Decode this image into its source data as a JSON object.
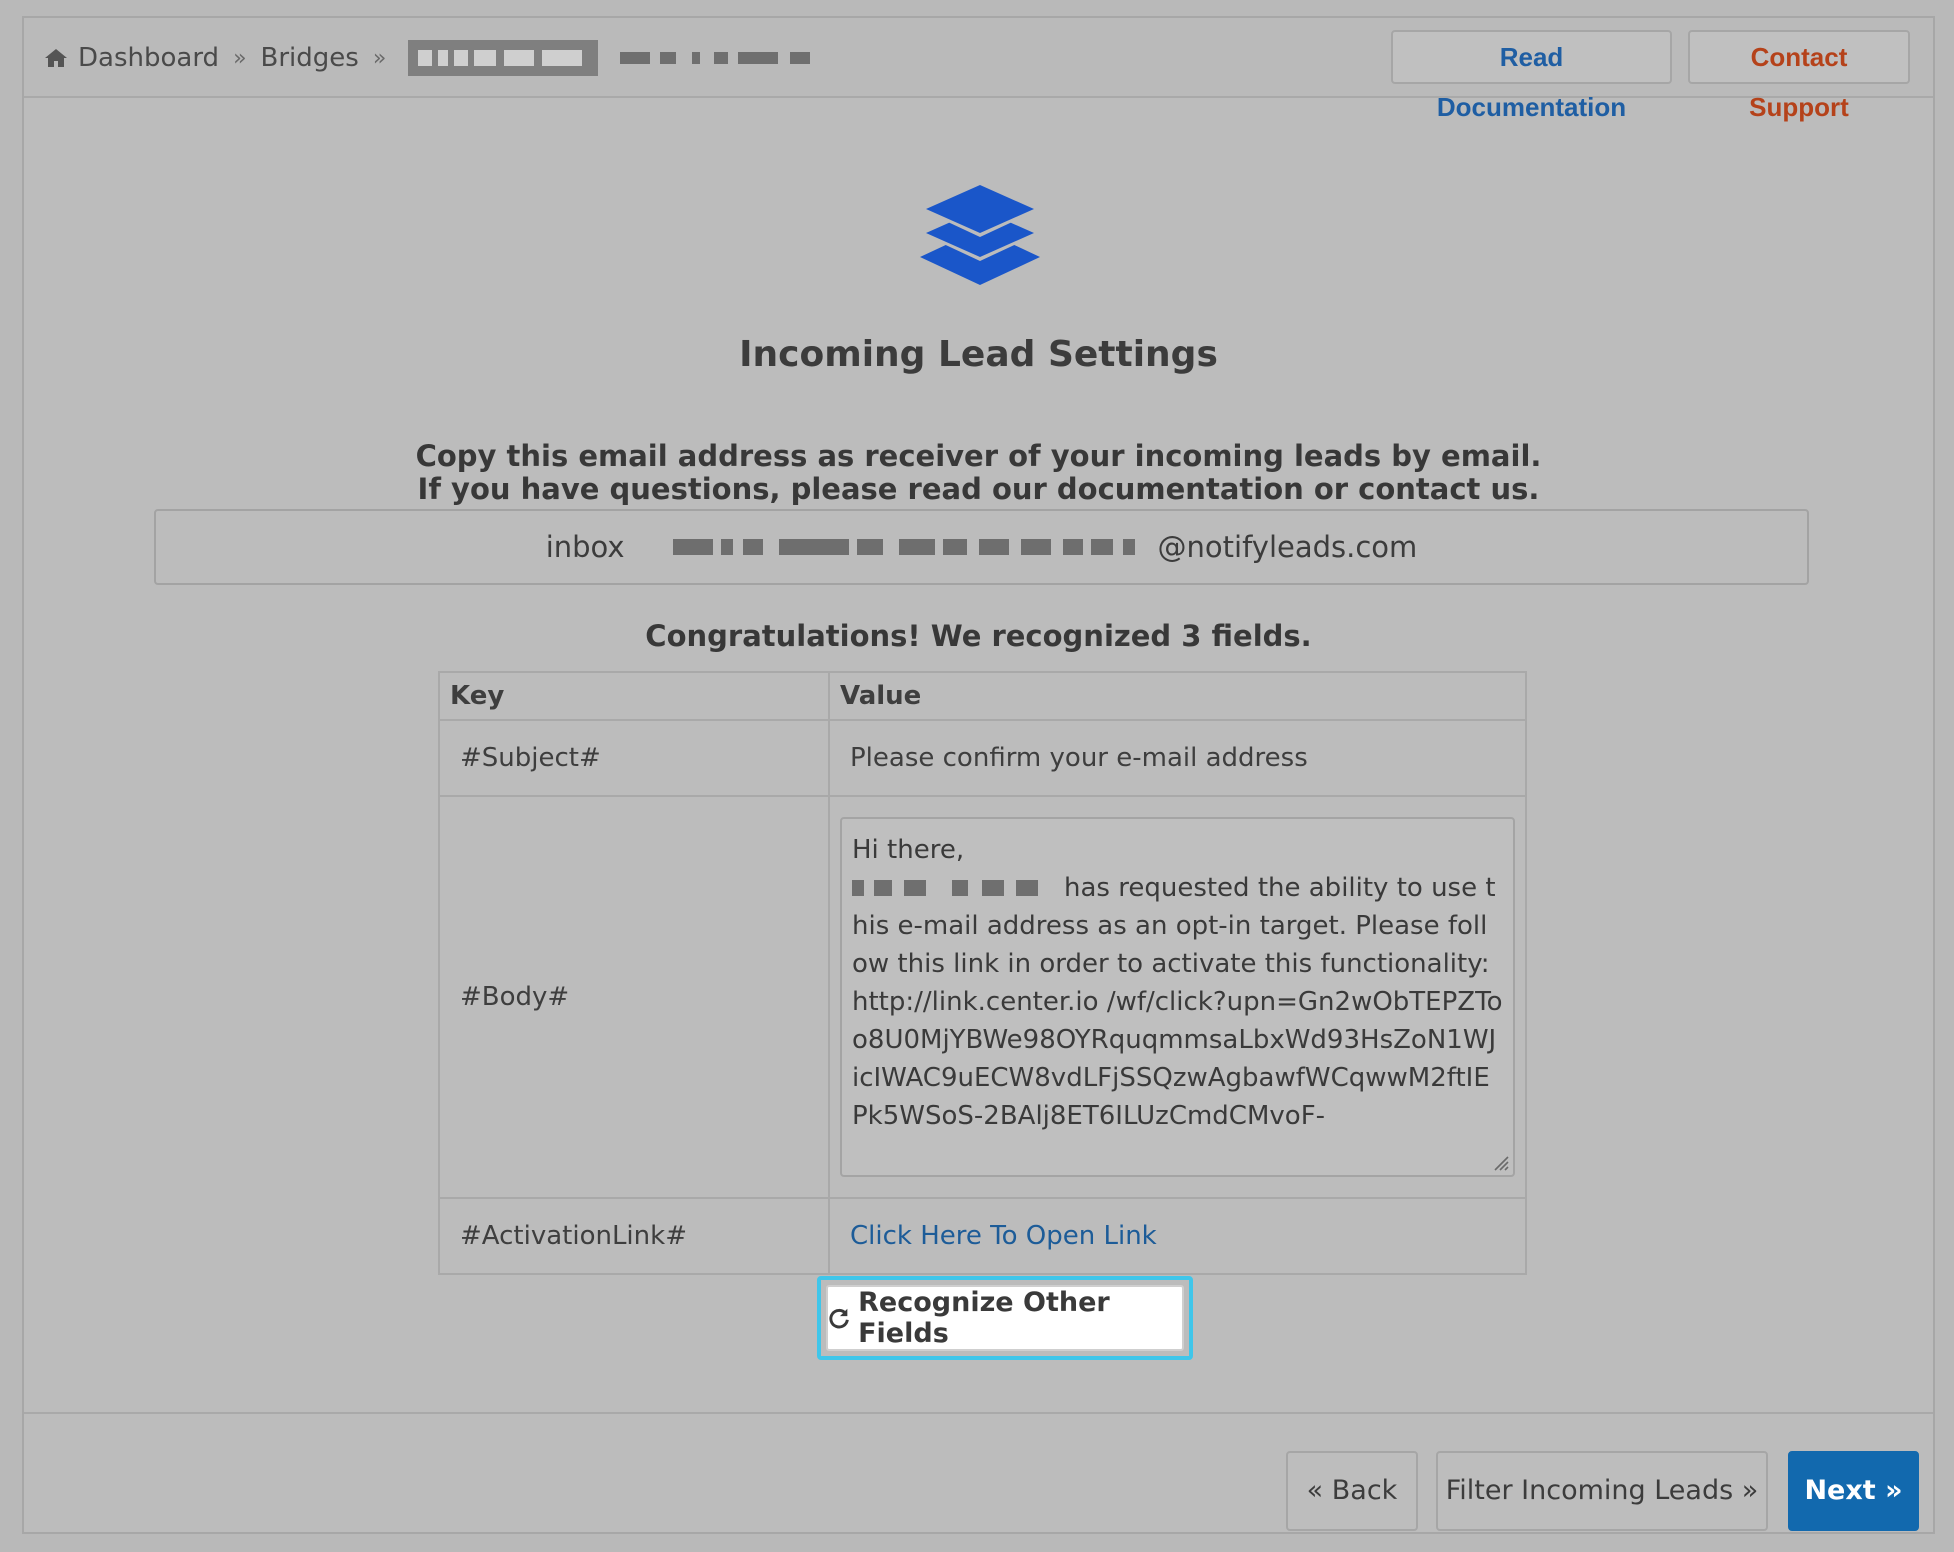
{
  "breadcrumb": {
    "home_label": "Dashboard",
    "separator": "»",
    "bridges_label": "Bridges"
  },
  "header": {
    "docs_label": "Read Documentation",
    "support_label": "Contact Support"
  },
  "page": {
    "icon": "layers-icon",
    "title": "Incoming Lead Settings",
    "intro_line1": "Copy this email address as receiver of your incoming leads by email.",
    "intro_line2": "If you have questions, please read our documentation or contact us."
  },
  "email": {
    "prefix": "inbox",
    "domain": "@notifyleads.com"
  },
  "recognition": {
    "message": "Congratulations! We recognized 3 fields.",
    "columns": {
      "key": "Key",
      "value": "Value"
    },
    "rows": [
      {
        "key": "#Subject#",
        "value": "Please confirm your e-mail address"
      },
      {
        "key": "#Body#",
        "value_intro": "Hi there,",
        "value_text": "has requested the ability to use this e-mail address as an opt-in target. Please follow this link in order to activate this functionality: http://link.center.io /wf/click?upn=Gn2wObTEPZToo8U0MjYBWe98OYRquqmmsaLbxWd93HsZoN1WJicIWAC9uECW8vdLFjSSQzwAgbawfWCqwwM2ftIEPk5WSoS-2BAlj8ET6ILUzCmdCMvoF-"
      },
      {
        "key": "#ActivationLink#",
        "value": "Click Here To Open Link"
      }
    ],
    "recognize_label": "Recognize Other Fields"
  },
  "footer": {
    "back_label": "« Back",
    "filter_label": "Filter Incoming Leads »",
    "next_label": "Next »"
  },
  "colors": {
    "accent_link": "#1f5ea3",
    "support": "#b5421a",
    "primary": "#1269ae",
    "icon_blue": "#1a56c9",
    "focus_ring": "#3fc6ea"
  }
}
